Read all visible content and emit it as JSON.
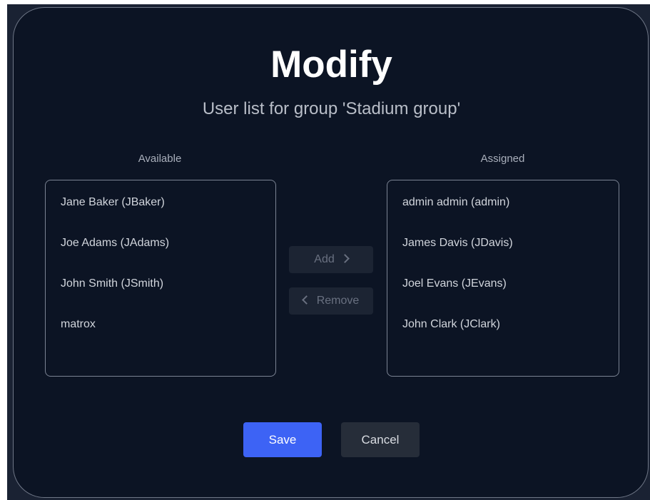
{
  "dialog": {
    "title": "Modify",
    "subtitle": "User list for group 'Stadium group'"
  },
  "available": {
    "label": "Available",
    "items": [
      "Jane Baker (JBaker)",
      "Joe Adams (JAdams)",
      "John Smith (JSmith)",
      "matrox"
    ]
  },
  "assigned": {
    "label": "Assigned",
    "items": [
      "admin admin (admin)",
      "James Davis (JDavis)",
      "Joel Evans (JEvans)",
      "John Clark (JClark)"
    ]
  },
  "transfer": {
    "add_label": "Add",
    "remove_label": "Remove",
    "add_icon": "chevron-right-icon",
    "remove_icon": "chevron-left-icon"
  },
  "actions": {
    "save_label": "Save",
    "cancel_label": "Cancel"
  },
  "colors": {
    "dialog_background": "#0c1424",
    "primary_button": "#3d63f5",
    "secondary_button": "#262d39",
    "disabled_button": "#1c2433",
    "list_border": "#7b8393"
  }
}
